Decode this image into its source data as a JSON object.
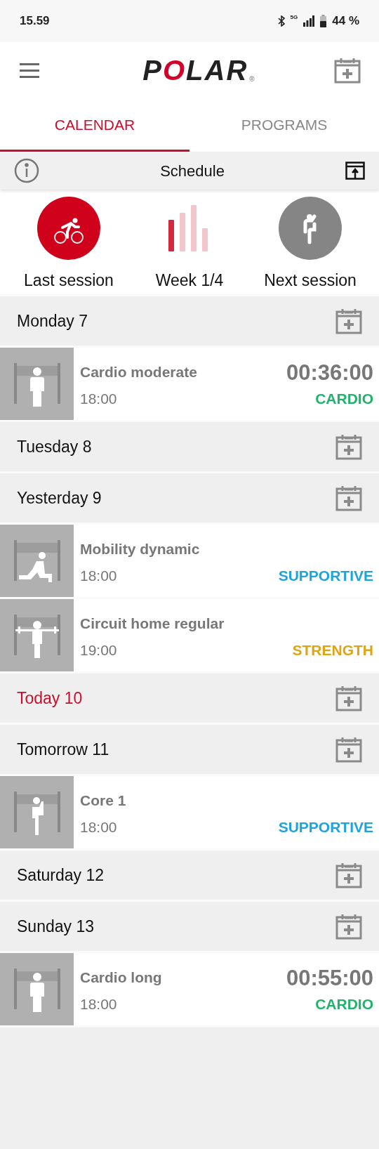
{
  "status_bar": {
    "time": "15.59",
    "network": "5G",
    "battery": "44 %"
  },
  "header": {
    "logo": {
      "before": "P",
      "mark": "O",
      "after": "LAR",
      "registered": "®"
    }
  },
  "tabs": [
    {
      "label": "CALENDAR",
      "selected": true
    },
    {
      "label": "PROGRAMS",
      "selected": false
    }
  ],
  "toolbar": {
    "title": "Schedule"
  },
  "overview": [
    {
      "kind": "last",
      "label": "Last session"
    },
    {
      "kind": "week",
      "label": "Week 1/4"
    },
    {
      "kind": "next",
      "label": "Next session"
    }
  ],
  "days": [
    {
      "label": "Monday 7",
      "today": false,
      "sessions": [
        {
          "kind": "standing",
          "name": "Cardio moderate",
          "time": "18:00",
          "duration": "00:36:00",
          "category": "CARDIO",
          "color": "#1fb36b"
        }
      ]
    },
    {
      "label": "Tuesday 8",
      "today": false
    },
    {
      "label": "Yesterday 9",
      "today": false,
      "sessions": [
        {
          "kind": "lunge",
          "name": "Mobility dynamic",
          "time": "18:00",
          "category": "SUPPORTIVE",
          "color": "#1ea3dc"
        },
        {
          "kind": "barbell",
          "name": "Circuit home regular",
          "time": "19:00",
          "category": "STRENGTH",
          "color": "#dba514"
        }
      ]
    },
    {
      "label": "Today 10",
      "today": true
    },
    {
      "label": "Tomorrow 11",
      "today": false,
      "sessions": [
        {
          "kind": "knee",
          "name": "Core 1",
          "time": "18:00",
          "category": "SUPPORTIVE",
          "color": "#1ea3dc"
        }
      ]
    },
    {
      "label": "Saturday 12",
      "today": false
    },
    {
      "label": "Sunday 13",
      "today": false,
      "sessions": [
        {
          "kind": "standing",
          "name": "Cardio long",
          "time": "18:00",
          "duration": "00:55:00",
          "category": "CARDIO",
          "color": "#1fb36b"
        }
      ]
    }
  ]
}
